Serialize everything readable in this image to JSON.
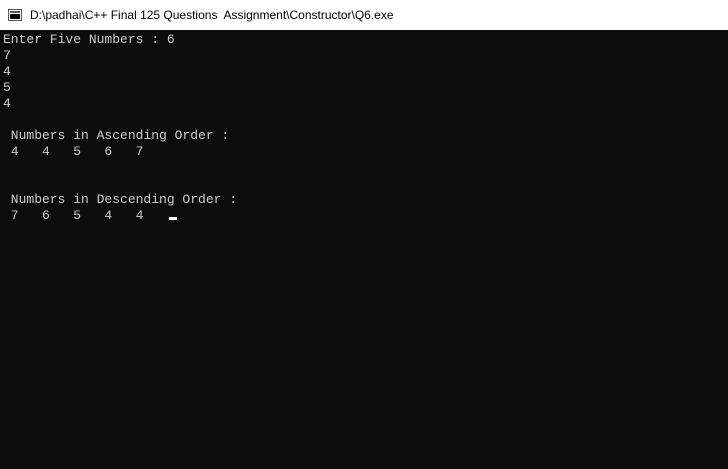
{
  "window": {
    "title": "D:\\padhai\\C++ Final 125 Questions  Assignment\\Constructor\\Q6.exe",
    "icon": "console-app-icon"
  },
  "console": {
    "lines": [
      "Enter Five Numbers : 6",
      "7",
      "4",
      "5",
      "4",
      "",
      " Numbers in Ascending Order :",
      " 4   4   5   6   7",
      "",
      "",
      " Numbers in Descending Order :",
      " 7   6   5   4   4   "
    ],
    "colors": {
      "background": "#0c0c0c",
      "text": "#cccccc",
      "cursor": "#ffffff"
    }
  }
}
